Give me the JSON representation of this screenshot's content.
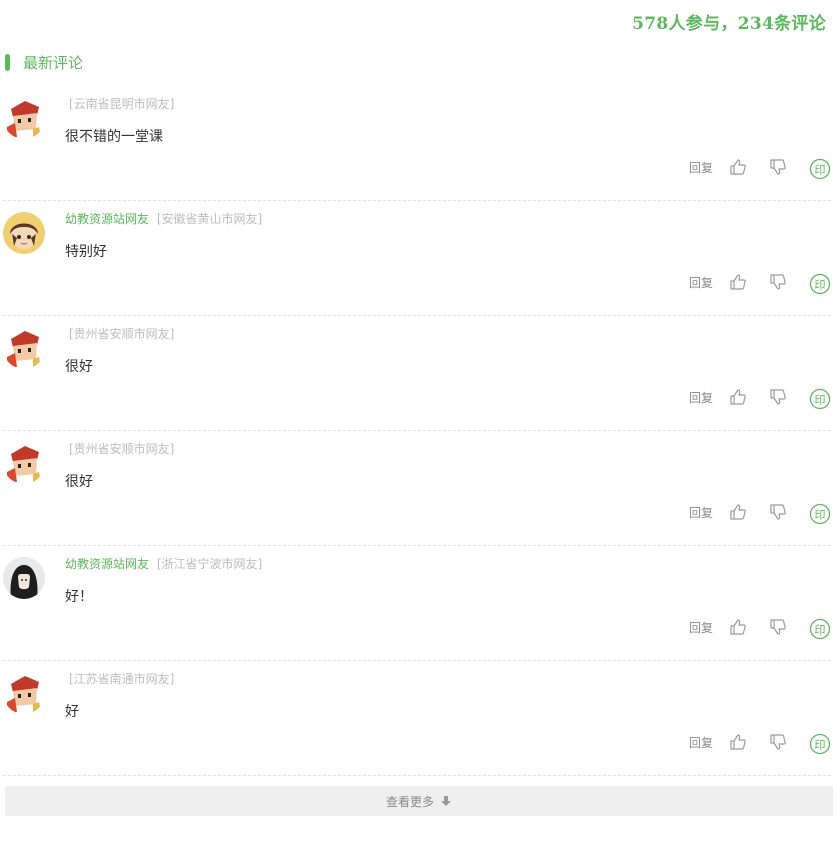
{
  "header": {
    "stats": "578人参与，234条评论"
  },
  "section": {
    "title": "最新评论"
  },
  "comments": [
    {
      "user": "",
      "location": "[云南省昆明市网友]",
      "content": "很不错的一堂课",
      "avatar": "cartoon-default"
    },
    {
      "user": "幼教资源站网友",
      "location": "[安徽省黄山市网友]",
      "content": "特别好",
      "avatar": "anime-boy"
    },
    {
      "user": "",
      "location": "[贵州省安顺市网友]",
      "content": "很好",
      "avatar": "cartoon-default"
    },
    {
      "user": "",
      "location": "[贵州省安顺市网友]",
      "content": "很好",
      "avatar": "cartoon-default"
    },
    {
      "user": "幼教资源站网友",
      "location": "[浙江省宁波市网友]",
      "content": "好！",
      "avatar": "dark-hair-girl"
    },
    {
      "user": "",
      "location": "[江苏省南通市网友]",
      "content": "好",
      "avatar": "cartoon-default"
    }
  ],
  "actions": {
    "reply": "回复",
    "like_icon": "thumb-up-icon",
    "dislike_icon": "thumb-down-icon",
    "share_icon": "seal-icon",
    "seal_char": "印"
  },
  "more": {
    "label": "查看更多",
    "icon": "arrow-down-icon"
  },
  "colors": {
    "accent": "#5cb85c",
    "muted": "#bdbdbd",
    "action": "#8a8a8a",
    "divider": "#e2e2e2"
  }
}
